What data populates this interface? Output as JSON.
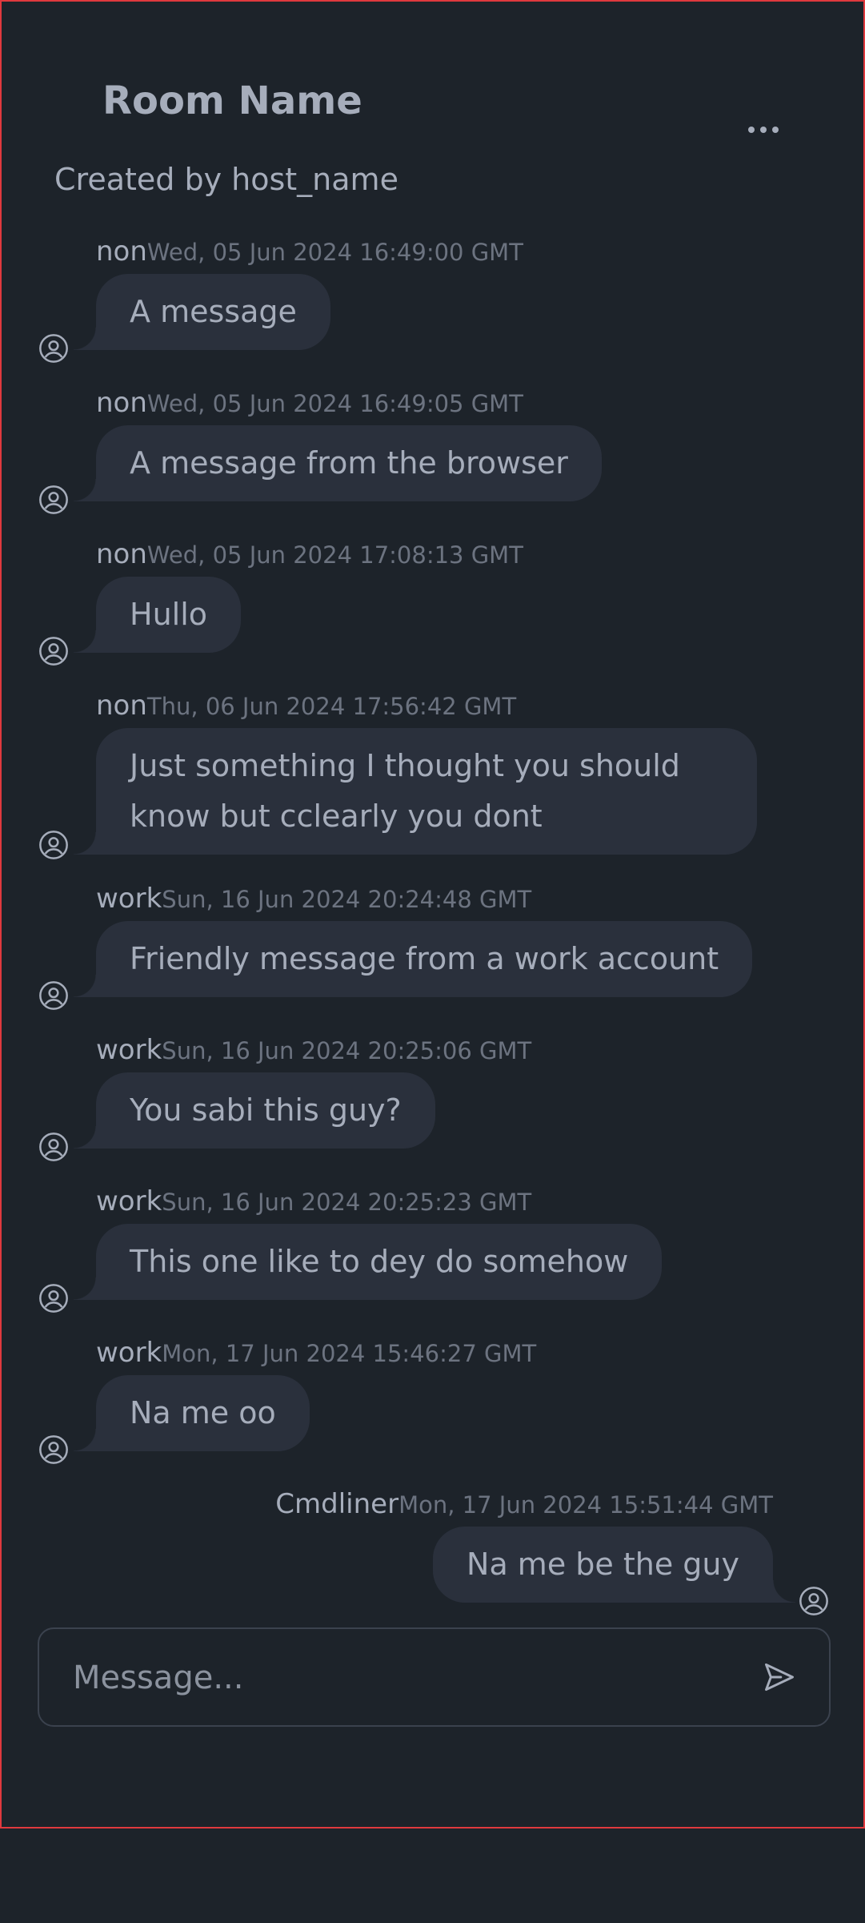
{
  "room": {
    "title": "Room Name",
    "created_by": "Created by host_name"
  },
  "messages": [
    {
      "author": "non",
      "time": "Wed, 05 Jun 2024 16:49:00 GMT",
      "text": "A message",
      "side": "left"
    },
    {
      "author": "non",
      "time": "Wed, 05 Jun 2024 16:49:05 GMT",
      "text": "A message from the browser",
      "side": "left"
    },
    {
      "author": "non",
      "time": "Wed, 05 Jun 2024 17:08:13 GMT",
      "text": "Hullo",
      "side": "left"
    },
    {
      "author": "non",
      "time": "Thu, 06 Jun 2024 17:56:42 GMT",
      "text": "Just something I thought you should know but cclearly you dont",
      "side": "left"
    },
    {
      "author": "work",
      "time": "Sun, 16 Jun 2024 20:24:48 GMT",
      "text": "Friendly message from a work account",
      "side": "left"
    },
    {
      "author": "work",
      "time": "Sun, 16 Jun 2024 20:25:06 GMT",
      "text": "You sabi this guy?",
      "side": "left"
    },
    {
      "author": "work",
      "time": "Sun, 16 Jun 2024 20:25:23 GMT",
      "text": "This one like to dey do somehow",
      "side": "left"
    },
    {
      "author": "work",
      "time": "Mon, 17 Jun 2024 15:46:27 GMT",
      "text": "Na me oo",
      "side": "left"
    },
    {
      "author": "Cmdliner",
      "time": "Mon, 17 Jun 2024 15:51:44 GMT",
      "text": "Na me be the guy",
      "side": "right"
    }
  ],
  "composer": {
    "placeholder": "Message..."
  },
  "icons": {
    "avatar": "user-circle-icon",
    "menu": "ellipsis-icon",
    "send": "send-icon"
  }
}
